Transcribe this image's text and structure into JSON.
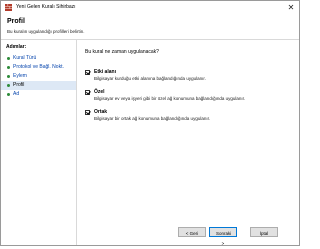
{
  "window": {
    "title": "Yeni Gelen Kuralı Sihirbazı",
    "close_glyph": "✕"
  },
  "header": {
    "title": "Profil",
    "description": "Bu kuralın uygulandığı profilleri belirtin."
  },
  "sidebar": {
    "heading": "Adımlar:",
    "items": [
      {
        "label": "Kural Türü"
      },
      {
        "label": "Protokol ve Bağl. Nokt."
      },
      {
        "label": "Eylem"
      },
      {
        "label": "Profil"
      },
      {
        "label": "Ad"
      }
    ]
  },
  "main": {
    "question": "Bu kural ne zaman uygulanacak?",
    "options": [
      {
        "title": "Etki alanı",
        "description": "Bilgisayar kurduğu etki alanına bağlandığında uygulanır.",
        "checked": true
      },
      {
        "title": "Özel",
        "description": "Bilgisayar ev veya işyeri gibi bir özel ağ konumuna bağlandığında uygulanır.",
        "checked": true
      },
      {
        "title": "Ortak",
        "description": "Bilgisayar bir ortak ağ konumuna bağlandığında uygulanır.",
        "checked": true
      }
    ]
  },
  "buttons": {
    "back": "< Geri",
    "next": "Sonraki >",
    "cancel": "İptal"
  },
  "colors": {
    "active_step_bg": "#dde8f5",
    "link": "#0645ad",
    "step_bullet": "#2e8b3a",
    "primary_border": "#0078d7"
  }
}
